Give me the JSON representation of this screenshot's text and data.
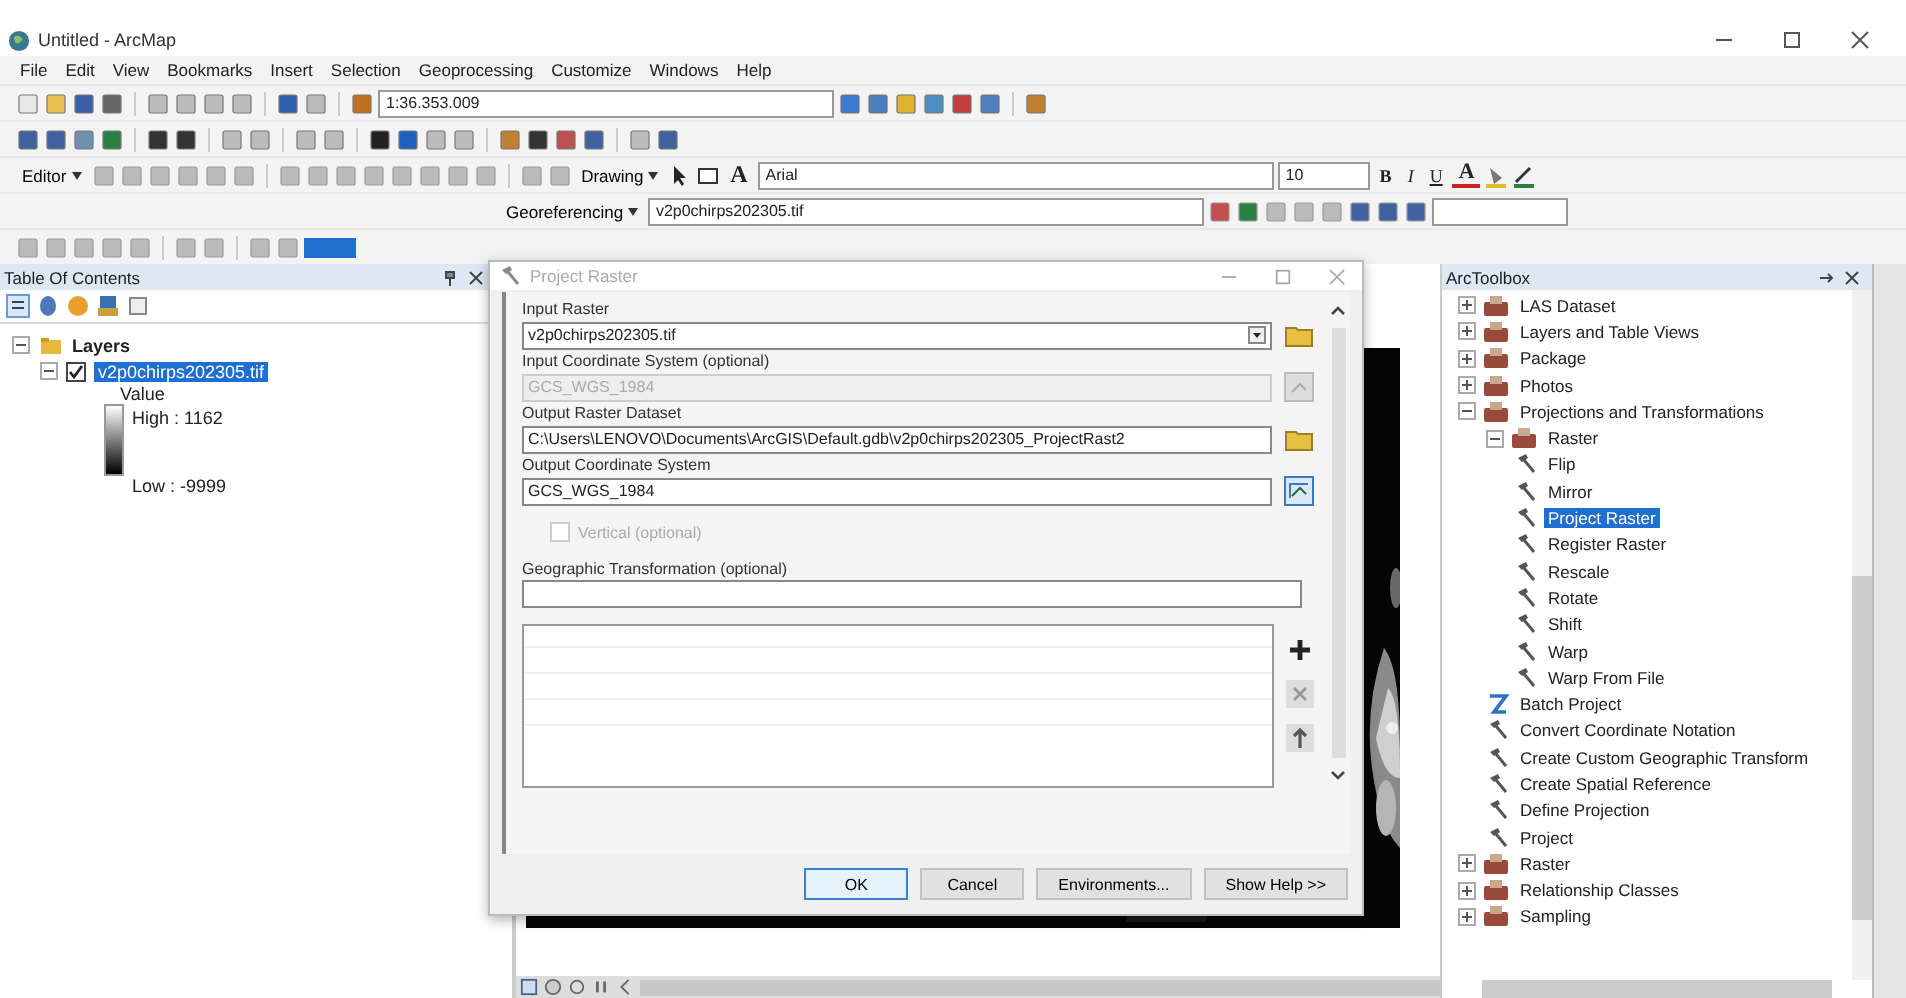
{
  "window": {
    "title": "Untitled - ArcMap"
  },
  "menu": [
    "File",
    "Edit",
    "View",
    "Bookmarks",
    "Insert",
    "Selection",
    "Geoprocessing",
    "Customize",
    "Windows",
    "Help"
  ],
  "toolbars": {
    "scale": "1:36.353.009",
    "editor": "Editor",
    "drawing": "Drawing",
    "text_tool": "A",
    "font": "Arial",
    "font_size": "10",
    "bold": "B",
    "italic": "I",
    "underline": "U",
    "font_color": "A",
    "georeferencing": "Georeferencing",
    "geo_layer": "v2p0chirps202305.tif"
  },
  "toc": {
    "title": "Table Of Contents",
    "root": {
      "label": "Layers",
      "expanded": true,
      "children": [
        {
          "label": "v2p0chirps202305.tif",
          "checked": true,
          "selected": true,
          "expanded": true,
          "legend": {
            "heading": "Value",
            "high": "High : 1162",
            "low": "Low : -9999"
          }
        }
      ]
    }
  },
  "dialog": {
    "title": "Project Raster",
    "fields": [
      {
        "kind": "dropdown",
        "label": "Input Raster",
        "value": "v2p0chirps202305.tif",
        "disabled": false
      },
      {
        "kind": "text",
        "label": "Input Coordinate System (optional)",
        "value": "GCS_WGS_1984",
        "disabled": true
      },
      {
        "kind": "text",
        "label": "Output Raster Dataset",
        "value": "C:\\Users\\LENOVO\\Documents\\ArcGIS\\Default.gdb\\v2p0chirps202305_ProjectRast2",
        "disabled": false
      },
      {
        "kind": "coord",
        "label": "Output Coordinate System",
        "value": "GCS_WGS_1984",
        "disabled": false
      },
      {
        "kind": "checkbox",
        "label": "Vertical (optional)",
        "checked": false,
        "disabled": true
      },
      {
        "kind": "list",
        "label": "Geographic Transformation (optional)",
        "disabled": false
      }
    ],
    "buttons": [
      {
        "label": "OK",
        "selected": true
      },
      {
        "label": "Cancel",
        "selected": false
      },
      {
        "label": "Environments...",
        "selected": false
      },
      {
        "label": "Show Help >>",
        "selected": false
      }
    ]
  },
  "toolbox": {
    "title": "ArcToolbox",
    "items": [
      {
        "kind": "toolset",
        "label": "LAS Dataset",
        "expanded": false,
        "selected": false
      },
      {
        "kind": "toolset",
        "label": "Layers and Table Views",
        "expanded": false,
        "selected": false
      },
      {
        "kind": "toolset",
        "label": "Package",
        "expanded": false,
        "selected": false
      },
      {
        "kind": "toolset",
        "label": "Photos",
        "expanded": false,
        "selected": false
      },
      {
        "kind": "toolset",
        "label": "Projections and Transformations",
        "expanded": true,
        "selected": false,
        "children": [
          {
            "kind": "toolset",
            "label": "Raster",
            "expanded": true,
            "selected": false,
            "children": [
              {
                "kind": "tool",
                "label": "Flip",
                "selected": false
              },
              {
                "kind": "tool",
                "label": "Mirror",
                "selected": false
              },
              {
                "kind": "tool",
                "label": "Project Raster",
                "selected": true
              },
              {
                "kind": "tool",
                "label": "Register Raster",
                "selected": false
              },
              {
                "kind": "tool",
                "label": "Rescale",
                "selected": false
              },
              {
                "kind": "tool",
                "label": "Rotate",
                "selected": false
              },
              {
                "kind": "tool",
                "label": "Shift",
                "selected": false
              },
              {
                "kind": "tool",
                "label": "Warp",
                "selected": false
              },
              {
                "kind": "tool",
                "label": "Warp From File",
                "selected": false
              }
            ]
          },
          {
            "kind": "script",
            "label": "Batch Project",
            "selected": false
          },
          {
            "kind": "tool",
            "label": "Convert Coordinate Notation",
            "selected": false
          },
          {
            "kind": "tool",
            "label": "Create Custom Geographic Transform",
            "selected": false
          },
          {
            "kind": "tool",
            "label": "Create Spatial Reference",
            "selected": false
          },
          {
            "kind": "tool",
            "label": "Define Projection",
            "selected": false
          },
          {
            "kind": "tool",
            "label": "Project",
            "selected": false
          }
        ]
      },
      {
        "kind": "toolset",
        "label": "Raster",
        "expanded": false,
        "selected": false
      },
      {
        "kind": "toolset",
        "label": "Relationship Classes",
        "expanded": false,
        "selected": false
      },
      {
        "kind": "toolset",
        "label": "Sampling",
        "expanded": false,
        "selected": false
      }
    ]
  }
}
